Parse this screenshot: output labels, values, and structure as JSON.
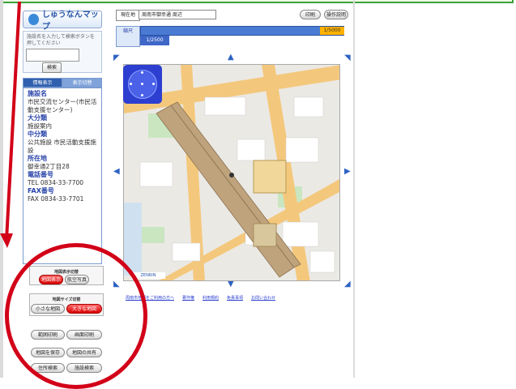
{
  "app": {
    "logo_text": "しゅうなんマップ"
  },
  "search": {
    "hint": "施設名を入力して検索ボタンを押してください",
    "input_value": "",
    "button_label": "検索"
  },
  "info": {
    "tabs": [
      "情報表示",
      "表示切替"
    ],
    "rows": [
      {
        "heading": "施設名",
        "value": "市民交流センター(市民活動支援センター)"
      },
      {
        "heading": "大分類",
        "value": "施設案内"
      },
      {
        "heading": "中分類",
        "value": "公共施設 市民活動支援施設"
      },
      {
        "heading": "所在地",
        "value": "御幸通2丁目28"
      },
      {
        "heading": "電話番号",
        "value": "TEL 0834-33-7700"
      },
      {
        "heading": "FAX番号",
        "value": "FAX 0834-33-7701"
      }
    ]
  },
  "controls": {
    "box1_title": "地図表示切替",
    "box1_buttons": [
      "地図表示",
      "航空写真"
    ],
    "box2_title": "地図サイズ切替",
    "box2_buttons": [
      "小さな地図",
      "大きな地図"
    ],
    "extra_buttons": [
      "範囲印刷",
      "画面印刷",
      "地図を保存",
      "地図の共有",
      "住所検索",
      "施設検索"
    ]
  },
  "address": {
    "label": "現在地",
    "value": "周南市御幸通 周辺"
  },
  "toolbar": {
    "print_label": "印刷",
    "help_label": "操作説明"
  },
  "scale": {
    "label": "縮尺",
    "current": "1/2500",
    "marker": "1/5000"
  },
  "map": {
    "logo": "ZENRIN"
  },
  "links": [
    "周南市地図をご利用の方へ",
    "著作権",
    "利用規約",
    "免責事項",
    "お問い合わせ"
  ],
  "colors": {
    "accent": "#2f5fae",
    "annotation": "#d20018",
    "highlight_button": "#d90000"
  }
}
